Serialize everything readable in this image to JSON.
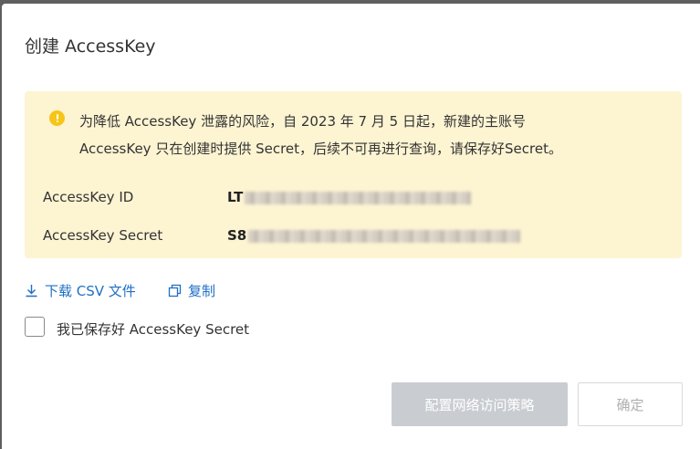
{
  "dialog": {
    "title": "创建 AccessKey",
    "alert": {
      "line1": "为降低 AccessKey 泄露的风险，自 2023 年 7 月 5 日起，新建的主账号",
      "line2": "AccessKey 只在创建时提供 Secret，后续不可再进行查询，请保存好Secret。",
      "icon": "warning-icon"
    },
    "fields": [
      {
        "label": "AccessKey ID",
        "value_prefix": "LT"
      },
      {
        "label": "AccessKey Secret",
        "value_prefix": "S8"
      }
    ],
    "actions": {
      "download_label": "下载 CSV 文件",
      "copy_label": "复制"
    },
    "confirm_checkbox_label": "我已保存好 AccessKey Secret",
    "buttons": {
      "configure_policy": "配置网络访问策略",
      "ok": "确定"
    }
  },
  "colors": {
    "alert_bg": "#fdf4d2",
    "warning": "#f5c518",
    "link": "#1f6fc4",
    "primary_disabled": "#c9ccd1"
  }
}
